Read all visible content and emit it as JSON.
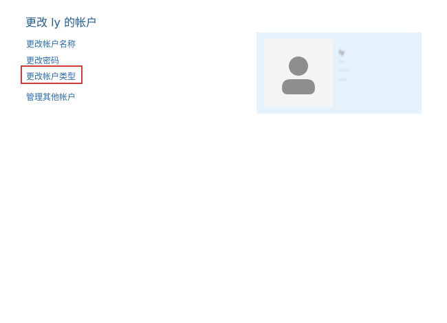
{
  "page": {
    "title": "更改 ly 的帐户"
  },
  "links": {
    "rename": "更改帐户名称",
    "password": "更改密码",
    "type": "更改帐户类型",
    "manage": "管理其他帐户"
  },
  "account": {
    "name": "ly",
    "line1": "····",
    "line2": "·······",
    "line3": "·····"
  },
  "colors": {
    "link": "#2a6bb1",
    "title": "#1f5c99",
    "highlight": "#d33a3a",
    "card_bg": "#e5f1fb"
  },
  "icons": {
    "avatar": "user-silhouette-icon"
  }
}
